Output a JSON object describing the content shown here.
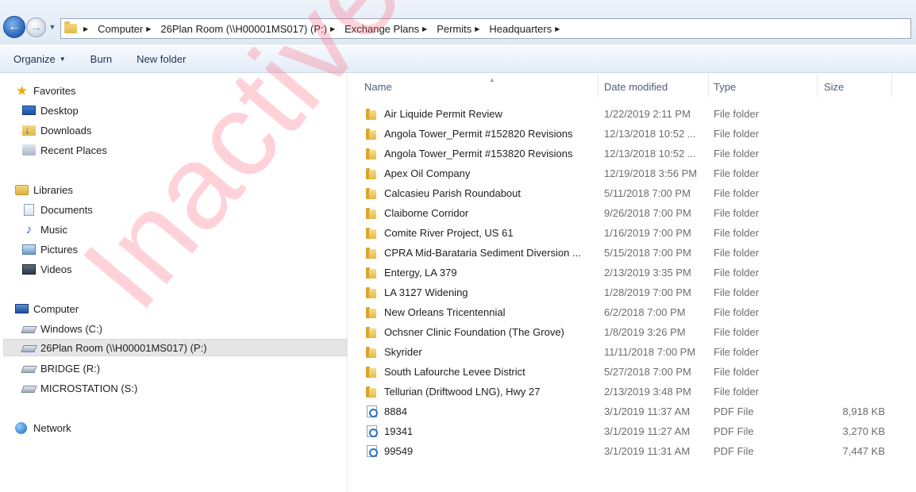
{
  "address": {
    "breadcrumbs": [
      "Computer",
      "26Plan Room (\\\\H00001MS017) (P:)",
      "Exchange Plans",
      "Permits",
      "Headquarters"
    ]
  },
  "toolbar": {
    "organize_label": "Organize",
    "burn_label": "Burn",
    "new_folder_label": "New folder"
  },
  "navpane": {
    "favorites": {
      "label": "Favorites",
      "items": [
        "Desktop",
        "Downloads",
        "Recent Places"
      ]
    },
    "libraries": {
      "label": "Libraries",
      "items": [
        "Documents",
        "Music",
        "Pictures",
        "Videos"
      ]
    },
    "computer": {
      "label": "Computer",
      "items": [
        "Windows (C:)",
        "26Plan Room (\\\\H00001MS017) (P:)",
        "BRIDGE (R:)",
        "MICROSTATION (S:)"
      ],
      "selected": "26Plan Room (\\\\H00001MS017) (P:)"
    },
    "network": {
      "label": "Network"
    }
  },
  "columns": {
    "name": "Name",
    "date": "Date modified",
    "type": "Type",
    "size": "Size"
  },
  "files": [
    {
      "name": "Air Liquide Permit Review",
      "date": "1/22/2019 2:11 PM",
      "type": "File folder",
      "size": "",
      "kind": "folder"
    },
    {
      "name": "Angola Tower_Permit #152820 Revisions",
      "date": "12/13/2018 10:52 ...",
      "type": "File folder",
      "size": "",
      "kind": "folder"
    },
    {
      "name": "Angola Tower_Permit #153820 Revisions",
      "date": "12/13/2018 10:52 ...",
      "type": "File folder",
      "size": "",
      "kind": "folder"
    },
    {
      "name": "Apex Oil Company",
      "date": "12/19/2018 3:56 PM",
      "type": "File folder",
      "size": "",
      "kind": "folder"
    },
    {
      "name": "Calcasieu Parish Roundabout",
      "date": "5/11/2018 7:00 PM",
      "type": "File folder",
      "size": "",
      "kind": "folder"
    },
    {
      "name": "Claiborne Corridor",
      "date": "9/26/2018 7:00 PM",
      "type": "File folder",
      "size": "",
      "kind": "folder"
    },
    {
      "name": "Comite River Project, US 61",
      "date": "1/16/2019 7:00 PM",
      "type": "File folder",
      "size": "",
      "kind": "folder"
    },
    {
      "name": "CPRA Mid-Barataria Sediment Diversion ...",
      "date": "5/15/2018 7:00 PM",
      "type": "File folder",
      "size": "",
      "kind": "folder"
    },
    {
      "name": "Entergy, LA 379",
      "date": "2/13/2019 3:35 PM",
      "type": "File folder",
      "size": "",
      "kind": "folder"
    },
    {
      "name": "LA 3127 Widening",
      "date": "1/28/2019 7:00 PM",
      "type": "File folder",
      "size": "",
      "kind": "folder"
    },
    {
      "name": "New Orleans Tricentennial",
      "date": "6/2/2018 7:00 PM",
      "type": "File folder",
      "size": "",
      "kind": "folder"
    },
    {
      "name": "Ochsner Clinic Foundation (The Grove)",
      "date": "1/8/2019 3:26 PM",
      "type": "File folder",
      "size": "",
      "kind": "folder"
    },
    {
      "name": "Skyrider",
      "date": "11/11/2018 7:00 PM",
      "type": "File folder",
      "size": "",
      "kind": "folder"
    },
    {
      "name": "South Lafourche Levee District",
      "date": "5/27/2018 7:00 PM",
      "type": "File folder",
      "size": "",
      "kind": "folder"
    },
    {
      "name": "Tellurian (Driftwood LNG), Hwy 27",
      "date": "2/13/2019 3:48 PM",
      "type": "File folder",
      "size": "",
      "kind": "folder"
    },
    {
      "name": "8884",
      "date": "3/1/2019 11:37 AM",
      "type": "PDF File",
      "size": "8,918 KB",
      "kind": "pdf"
    },
    {
      "name": "19341",
      "date": "3/1/2019 11:27 AM",
      "type": "PDF File",
      "size": "3,270 KB",
      "kind": "pdf"
    },
    {
      "name": "99549",
      "date": "3/1/2019 11:31 AM",
      "type": "PDF File",
      "size": "7,447 KB",
      "kind": "pdf"
    }
  ],
  "watermark": "Inactive"
}
